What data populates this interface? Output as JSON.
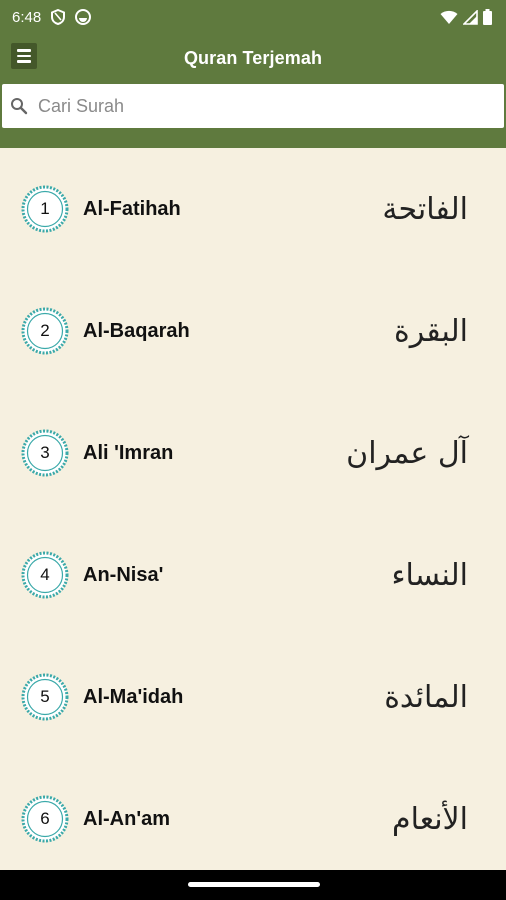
{
  "status_bar": {
    "time": "6:48",
    "icons": [
      "shield-icon",
      "circle-app-icon",
      "wifi-icon",
      "signal-icon",
      "battery-icon"
    ]
  },
  "app_bar": {
    "title": "Quran Terjemah",
    "menu_icon": "hamburger-menu-icon"
  },
  "search": {
    "placeholder": "Cari Surah",
    "value": ""
  },
  "surahs": [
    {
      "number": "1",
      "name": "Al-Fatihah",
      "arabic": "الفاتحة"
    },
    {
      "number": "2",
      "name": "Al-Baqarah",
      "arabic": "البقرة"
    },
    {
      "number": "3",
      "name": "Ali 'Imran",
      "arabic": "آل عمران"
    },
    {
      "number": "4",
      "name": "An-Nisa'",
      "arabic": "النساء"
    },
    {
      "number": "5",
      "name": "Al-Ma'idah",
      "arabic": "المائدة"
    },
    {
      "number": "6",
      "name": "Al-An'am",
      "arabic": "الأنعام"
    }
  ],
  "colors": {
    "primary": "#5f7a3e",
    "menu_button": "#44582a",
    "list_background": "#f6f0e0",
    "badge_ring": "#3aa9a9"
  }
}
